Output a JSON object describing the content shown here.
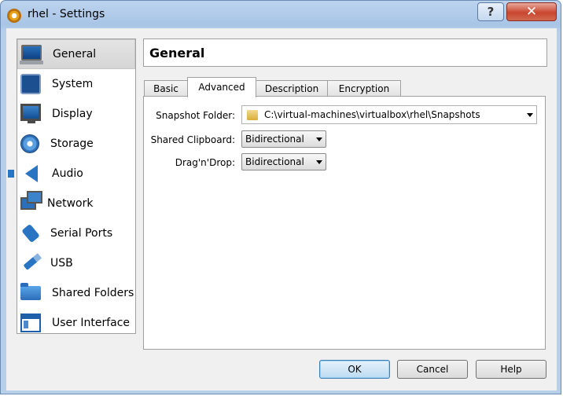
{
  "window": {
    "title": "rhel - Settings",
    "help_label": "?",
    "close_label": "✕"
  },
  "sidebar": {
    "items": [
      {
        "label": "General",
        "icon": "general-icon",
        "selected": true
      },
      {
        "label": "System",
        "icon": "system-icon"
      },
      {
        "label": "Display",
        "icon": "display-icon"
      },
      {
        "label": "Storage",
        "icon": "storage-icon"
      },
      {
        "label": "Audio",
        "icon": "audio-icon"
      },
      {
        "label": "Network",
        "icon": "network-icon"
      },
      {
        "label": "Serial Ports",
        "icon": "serial-ports-icon"
      },
      {
        "label": "USB",
        "icon": "usb-icon"
      },
      {
        "label": "Shared Folders",
        "icon": "shared-folders-icon"
      },
      {
        "label": "User Interface",
        "icon": "user-interface-icon"
      }
    ]
  },
  "header": {
    "title": "General"
  },
  "tabs": [
    {
      "label": "Basic"
    },
    {
      "label": "Advanced",
      "active": true
    },
    {
      "label": "Description"
    },
    {
      "label": "Encryption"
    }
  ],
  "advanced": {
    "snapshot_label": "Snapshot Folder:",
    "snapshot_value": "C:\\virtual-machines\\virtualbox\\rhel\\Snapshots",
    "clipboard_label": "Shared Clipboard:",
    "clipboard_value": "Bidirectional",
    "dragdrop_label": "Drag'n'Drop:",
    "dragdrop_value": "Bidirectional"
  },
  "buttons": {
    "ok": "OK",
    "cancel": "Cancel",
    "help": "Help"
  }
}
